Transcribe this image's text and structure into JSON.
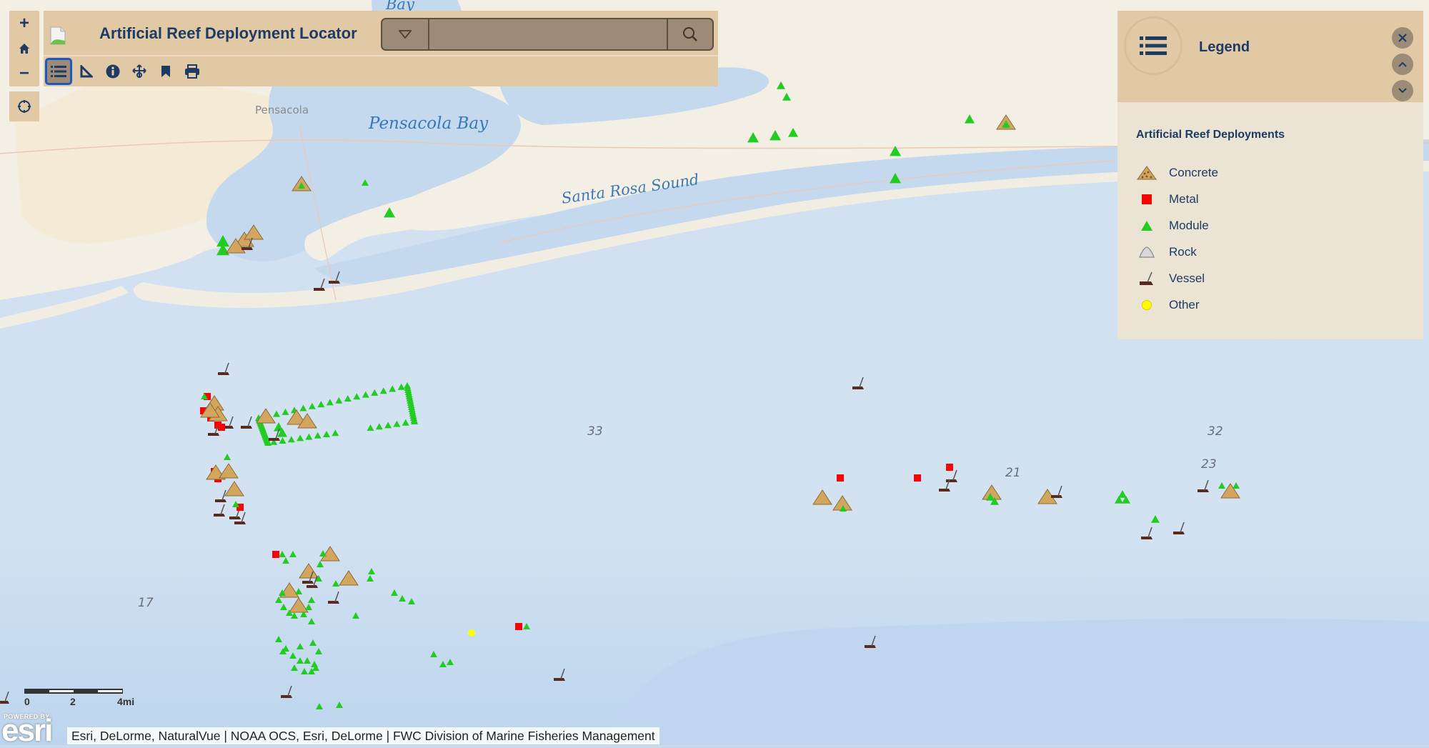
{
  "app": {
    "title": "Artificial Reef Deployment Locator"
  },
  "zoom_controls": {
    "zoom_in": "+",
    "home": "home-icon",
    "zoom_out": "−",
    "locate": "locate-icon"
  },
  "search": {
    "value": "",
    "placeholder": "",
    "dropdown_icon": "triangle-down-icon",
    "search_icon": "search-icon"
  },
  "toolbar": {
    "tools": [
      {
        "name": "legend",
        "icon": "list-icon",
        "active": true
      },
      {
        "name": "measure",
        "icon": "ruler-triangle-icon",
        "active": false
      },
      {
        "name": "about",
        "icon": "info-icon",
        "active": false
      },
      {
        "name": "basemap",
        "icon": "layers-arrows-icon",
        "active": false
      },
      {
        "name": "bookmarks",
        "icon": "bookmark-icon",
        "active": false
      },
      {
        "name": "print",
        "icon": "print-icon",
        "active": false
      }
    ]
  },
  "legend": {
    "title": "Legend",
    "layer_title": "Artificial Reef Deployments",
    "items": [
      {
        "label": "Concrete",
        "symbol": "concrete-pile",
        "color": "#d2a65e"
      },
      {
        "label": "Metal",
        "symbol": "square",
        "color": "#ff0000"
      },
      {
        "label": "Module",
        "symbol": "triangle",
        "color": "#22cc22"
      },
      {
        "label": "Rock",
        "symbol": "rock",
        "color": "#c8c8c8"
      },
      {
        "label": "Vessel",
        "symbol": "vessel",
        "color": "#5a2a1e"
      },
      {
        "label": "Other",
        "symbol": "circle",
        "color": "#ffff00"
      }
    ]
  },
  "map": {
    "place_labels": [
      {
        "text": "Bay",
        "kind": "water"
      },
      {
        "text": "Pensacola",
        "kind": "city"
      },
      {
        "text": "Pensacola Bay",
        "kind": "water"
      },
      {
        "text": "Santa Rosa Sound",
        "kind": "water"
      }
    ],
    "depth_labels": [
      "33",
      "32",
      "21",
      "23",
      "17"
    ],
    "scale": {
      "labels": [
        "0",
        "2",
        "4mi"
      ]
    },
    "powered_by": "POWERED BY",
    "esri": "esri",
    "attribution": "Esri, DeLorme, NaturalVue | NOAA OCS, Esri, DeLorme | FWC Division of Marine Fisheries Management"
  }
}
